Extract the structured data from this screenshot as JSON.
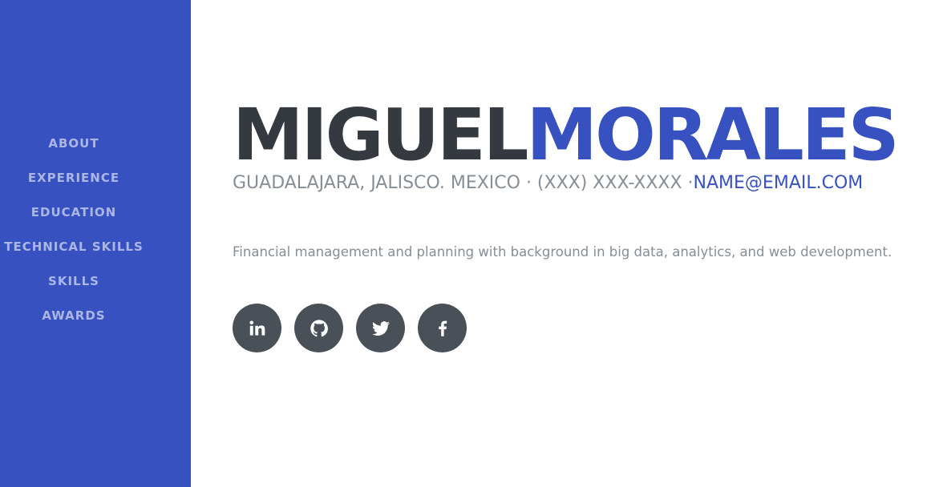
{
  "sidebar": {
    "background": "#3751c1",
    "nav": [
      {
        "label": "ABOUT"
      },
      {
        "label": "EXPERIENCE"
      },
      {
        "label": "EDUCATION"
      },
      {
        "label": "TECHNICAL SKILLS"
      },
      {
        "label": "SKILLS"
      },
      {
        "label": "AWARDS"
      }
    ]
  },
  "header": {
    "first_name": "MIGUEL",
    "last_name": "MORALES",
    "contact_location_phone": "GUADALAJARA, JALISCO. MEXICO · (XXX) XXX-XXXX ·",
    "email": "NAME@EMAIL.COM"
  },
  "summary": "Financial management and planning with background in big data, analytics, and web development.",
  "social_links": [
    {
      "icon": "linkedin-icon"
    },
    {
      "icon": "github-icon"
    },
    {
      "icon": "twitter-icon"
    },
    {
      "icon": "facebook-icon"
    }
  ],
  "colors": {
    "primary": "#3751c1",
    "dark_text": "#343a40",
    "muted_text": "#868e96",
    "social_bg": "#495057"
  }
}
